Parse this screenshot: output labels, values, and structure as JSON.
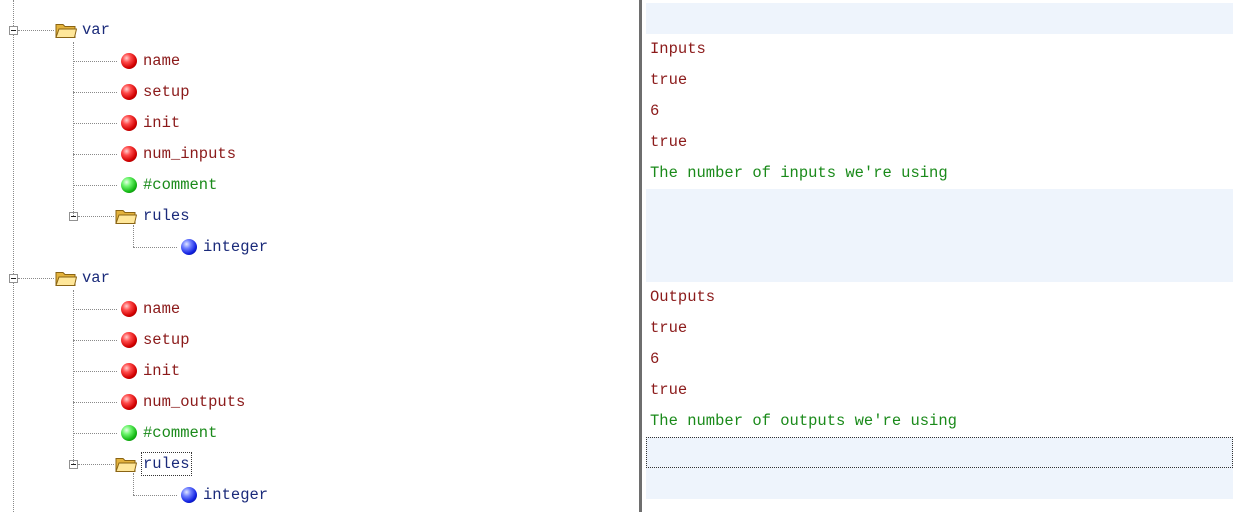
{
  "tree": {
    "groups": [
      {
        "label": "var",
        "children": [
          {
            "label": "name",
            "kind": "attribute",
            "icon": "red-ball-icon"
          },
          {
            "label": "setup",
            "kind": "attribute",
            "icon": "red-ball-icon"
          },
          {
            "label": "init",
            "kind": "attribute",
            "icon": "red-ball-icon"
          },
          {
            "label": "num_inputs",
            "kind": "attribute",
            "icon": "red-ball-icon"
          },
          {
            "label": "#comment",
            "kind": "comment",
            "icon": "green-ball-icon"
          }
        ],
        "rules": {
          "label": "rules",
          "child": "integer"
        }
      },
      {
        "label": "var",
        "children": [
          {
            "label": "name",
            "kind": "attribute",
            "icon": "red-ball-icon"
          },
          {
            "label": "setup",
            "kind": "attribute",
            "icon": "red-ball-icon"
          },
          {
            "label": "init",
            "kind": "attribute",
            "icon": "red-ball-icon"
          },
          {
            "label": "num_outputs",
            "kind": "attribute",
            "icon": "red-ball-icon"
          },
          {
            "label": "#comment",
            "kind": "comment",
            "icon": "green-ball-icon"
          }
        ],
        "rules": {
          "label": "rules",
          "child": "integer"
        }
      }
    ]
  },
  "values": [
    {
      "text": "",
      "kind": "blank"
    },
    {
      "text": "Inputs",
      "kind": "attribute"
    },
    {
      "text": "true",
      "kind": "attribute"
    },
    {
      "text": "6",
      "kind": "attribute"
    },
    {
      "text": "true",
      "kind": "attribute"
    },
    {
      "text": "The number of inputs we're using",
      "kind": "comment"
    },
    {
      "text": "",
      "kind": "blank"
    },
    {
      "text": "",
      "kind": "blank"
    },
    {
      "text": "",
      "kind": "blank"
    },
    {
      "text": "Outputs",
      "kind": "attribute"
    },
    {
      "text": "true",
      "kind": "attribute"
    },
    {
      "text": "6",
      "kind": "attribute"
    },
    {
      "text": "true",
      "kind": "attribute"
    },
    {
      "text": "The number of outputs we're using",
      "kind": "comment"
    },
    {
      "text": "",
      "kind": "focused"
    },
    {
      "text": "",
      "kind": "blank"
    }
  ],
  "colors": {
    "folder_text": "#1a2a7a",
    "attribute_text": "#8b1a1a",
    "comment_text": "#1a8a1a",
    "band_background": "#eef4fc"
  }
}
